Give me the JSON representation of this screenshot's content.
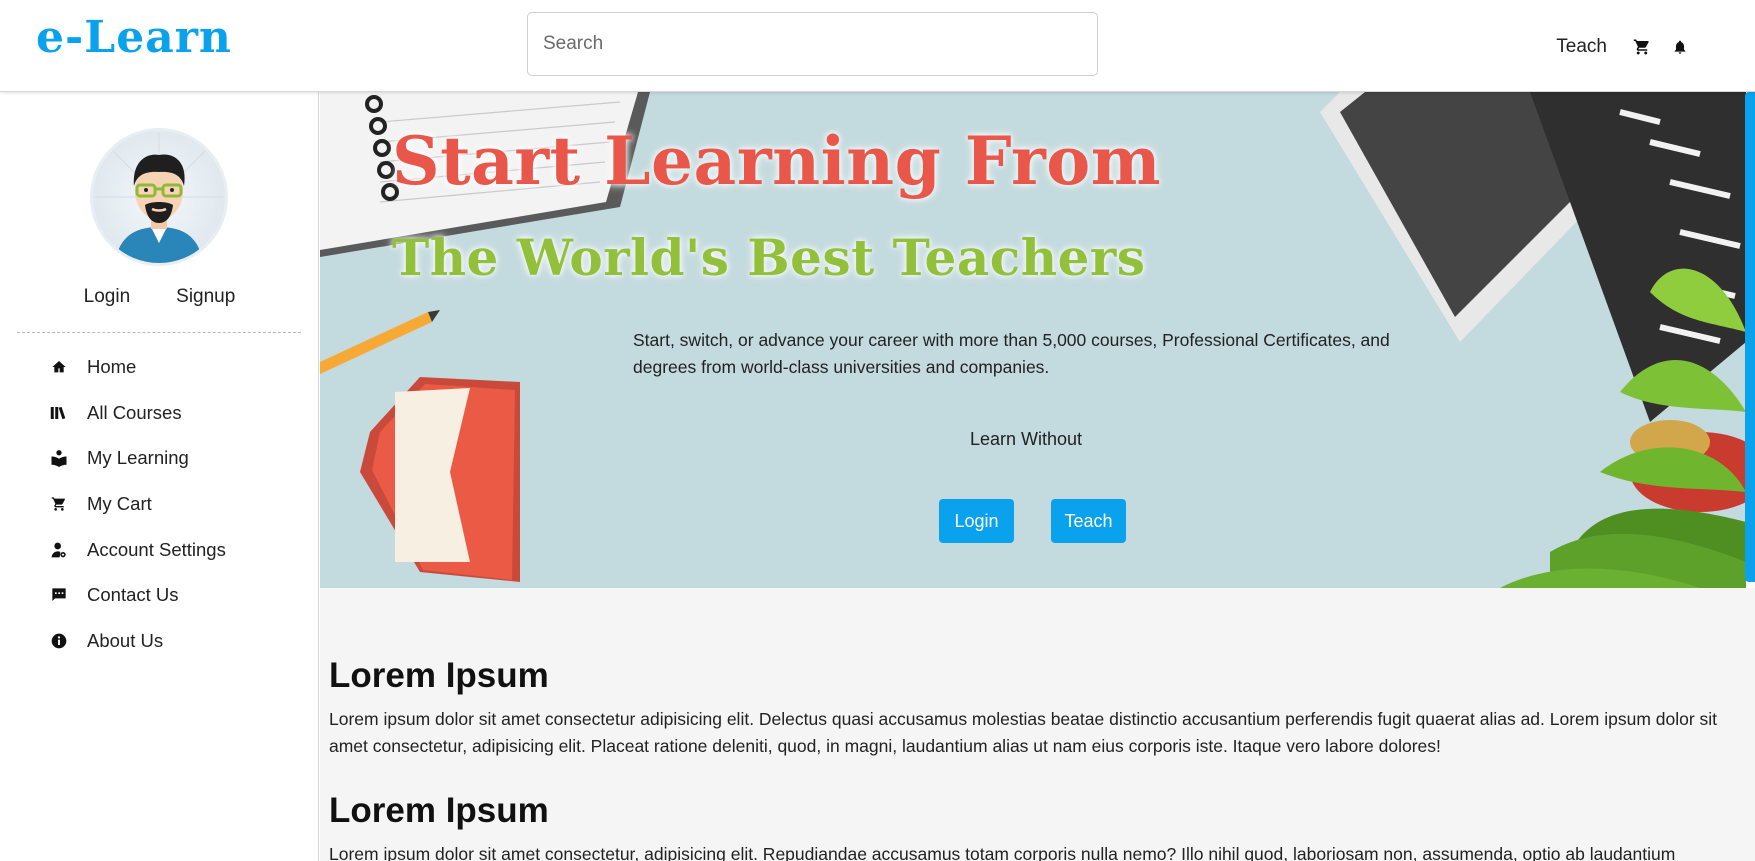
{
  "colors": {
    "brand": "#0aa2ec",
    "hero_title_primary": "#e8574a",
    "hero_title_secondary": "#92c03a",
    "hero_bg": "#c3dade",
    "content_bg": "#f5f5f5"
  },
  "header": {
    "logo": "e-Learn",
    "search_placeholder": "Search",
    "teach_link": "Teach",
    "cart_icon": "cart-icon",
    "bell_icon": "bell-icon"
  },
  "sidebar": {
    "avatar": "avatar",
    "login": "Login",
    "signup": "Signup",
    "items": [
      {
        "label": "Home",
        "icon": "home-icon"
      },
      {
        "label": "All Courses",
        "icon": "books-icon"
      },
      {
        "label": "My Learning",
        "icon": "reader-icon"
      },
      {
        "label": "My Cart",
        "icon": "cart-icon"
      },
      {
        "label": "Account Settings",
        "icon": "user-gear-icon"
      },
      {
        "label": "Contact Us",
        "icon": "chat-icon"
      },
      {
        "label": "About Us",
        "icon": "info-icon"
      }
    ]
  },
  "hero": {
    "title_line1": "Start Learning From",
    "title_line2": "The World's Best Teachers",
    "description": "Start, switch, or advance your career with more than 5,000 courses, Professional Certificates, and degrees from world-class universities and companies.",
    "tagline": "Learn Without",
    "login_button": "Login",
    "teach_button": "Teach"
  },
  "articles": [
    {
      "heading": "Lorem Ipsum",
      "body": "Lorem ipsum dolor sit amet consectetur adipisicing elit. Delectus quasi accusamus molestias beatae distinctio accusantium perferendis fugit quaerat alias ad. Lorem ipsum dolor sit amet consectetur, adipisicing elit. Placeat ratione deleniti, quod, in magni, laudantium alias ut nam eius corporis iste. Itaque vero labore dolores!"
    },
    {
      "heading": "Lorem Ipsum",
      "body": "Lorem ipsum dolor sit amet consectetur, adipisicing elit. Repudiandae accusamus totam corporis nulla nemo? Illo nihil quod, laboriosam non, assumenda, optio ab laudantium"
    }
  ]
}
